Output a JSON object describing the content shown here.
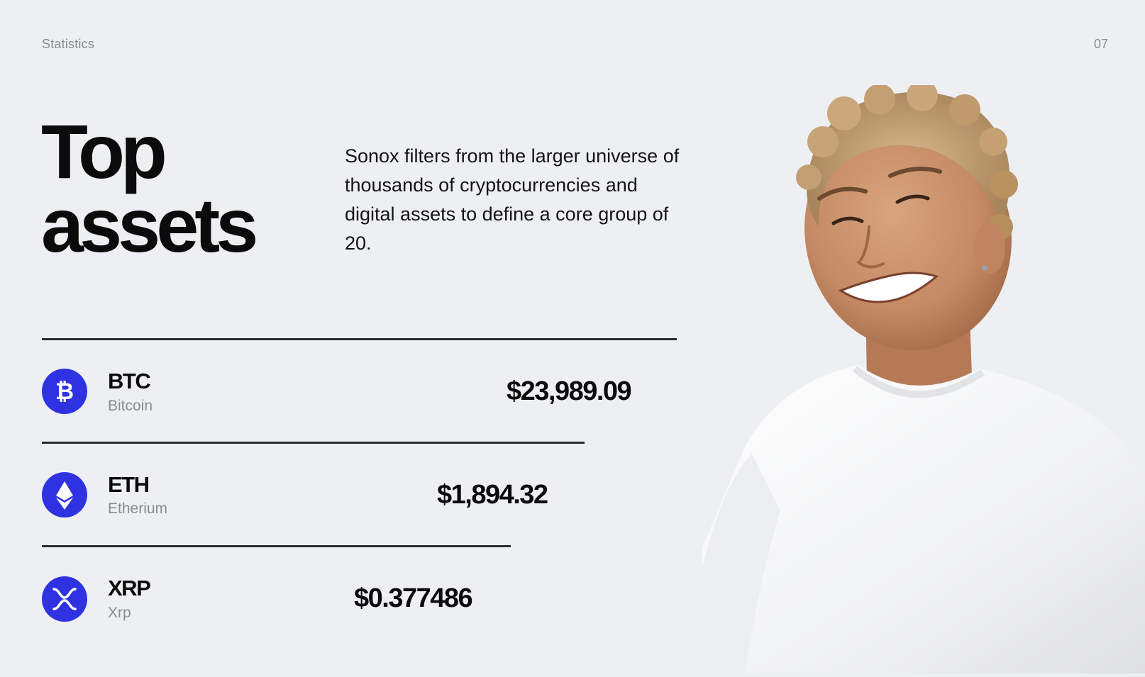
{
  "header": {
    "section": "Statistics",
    "page_number": "07"
  },
  "hero": {
    "title_line1": "Top",
    "title_line2": "assets",
    "description": "Sonox filters from the larger universe of thousands of cryptocurrencies and digital assets to define a core group of 20."
  },
  "assets": [
    {
      "ticker": "BTC",
      "name": "Bitcoin",
      "price": "$23,989.09",
      "icon": "bitcoin-icon"
    },
    {
      "ticker": "ETH",
      "name": "Etherium",
      "price": "$1,894.32",
      "icon": "ethereum-icon"
    },
    {
      "ticker": "XRP",
      "name": "Xrp",
      "price": "$0.377486",
      "icon": "xrp-icon"
    }
  ],
  "colors": {
    "background": "#eeeff3",
    "accent": "#2f32e0",
    "text": "#0b0b0c",
    "muted": "#8a8b90",
    "divider": "#2b2c30"
  },
  "image": {
    "subject": "smiling person with short curly hair in white t-shirt"
  }
}
